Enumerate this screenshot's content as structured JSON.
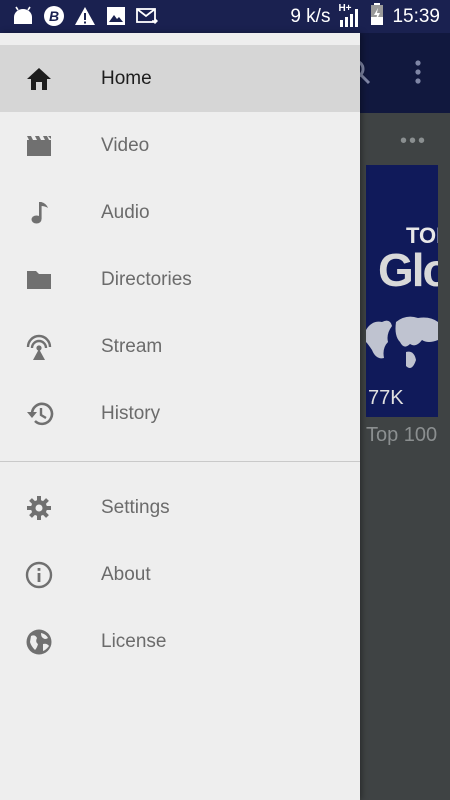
{
  "status_bar": {
    "notification_icons": [
      "android-icon",
      "b-app-icon",
      "warning-icon",
      "image-icon",
      "mail-icon"
    ],
    "speed": "9 k/s",
    "network": "H+",
    "time": "15:39"
  },
  "background_app": {
    "thumbnail_title_top": "TOP",
    "thumbnail_title_main": "Glo",
    "thumbnail_views": "77K",
    "caption": "Top 100"
  },
  "drawer": {
    "primary_items": [
      {
        "label": "Home",
        "icon": "home-icon",
        "active": true
      },
      {
        "label": "Video",
        "icon": "video-icon",
        "active": false
      },
      {
        "label": "Audio",
        "icon": "music-note-icon",
        "active": false
      },
      {
        "label": "Directories",
        "icon": "folder-icon",
        "active": false
      },
      {
        "label": "Stream",
        "icon": "stream-icon",
        "active": false
      },
      {
        "label": "History",
        "icon": "history-icon",
        "active": false
      }
    ],
    "secondary_items": [
      {
        "label": "Settings",
        "icon": "gear-icon"
      },
      {
        "label": "About",
        "icon": "info-icon"
      },
      {
        "label": "License",
        "icon": "globe-icon"
      }
    ]
  },
  "colors": {
    "status_bar": "#1a2150",
    "drawer_bg": "#eeeeee",
    "active_item_bg": "#d6d6d6",
    "icon_gray": "#707070",
    "active_icon": "#1d1d1d"
  }
}
